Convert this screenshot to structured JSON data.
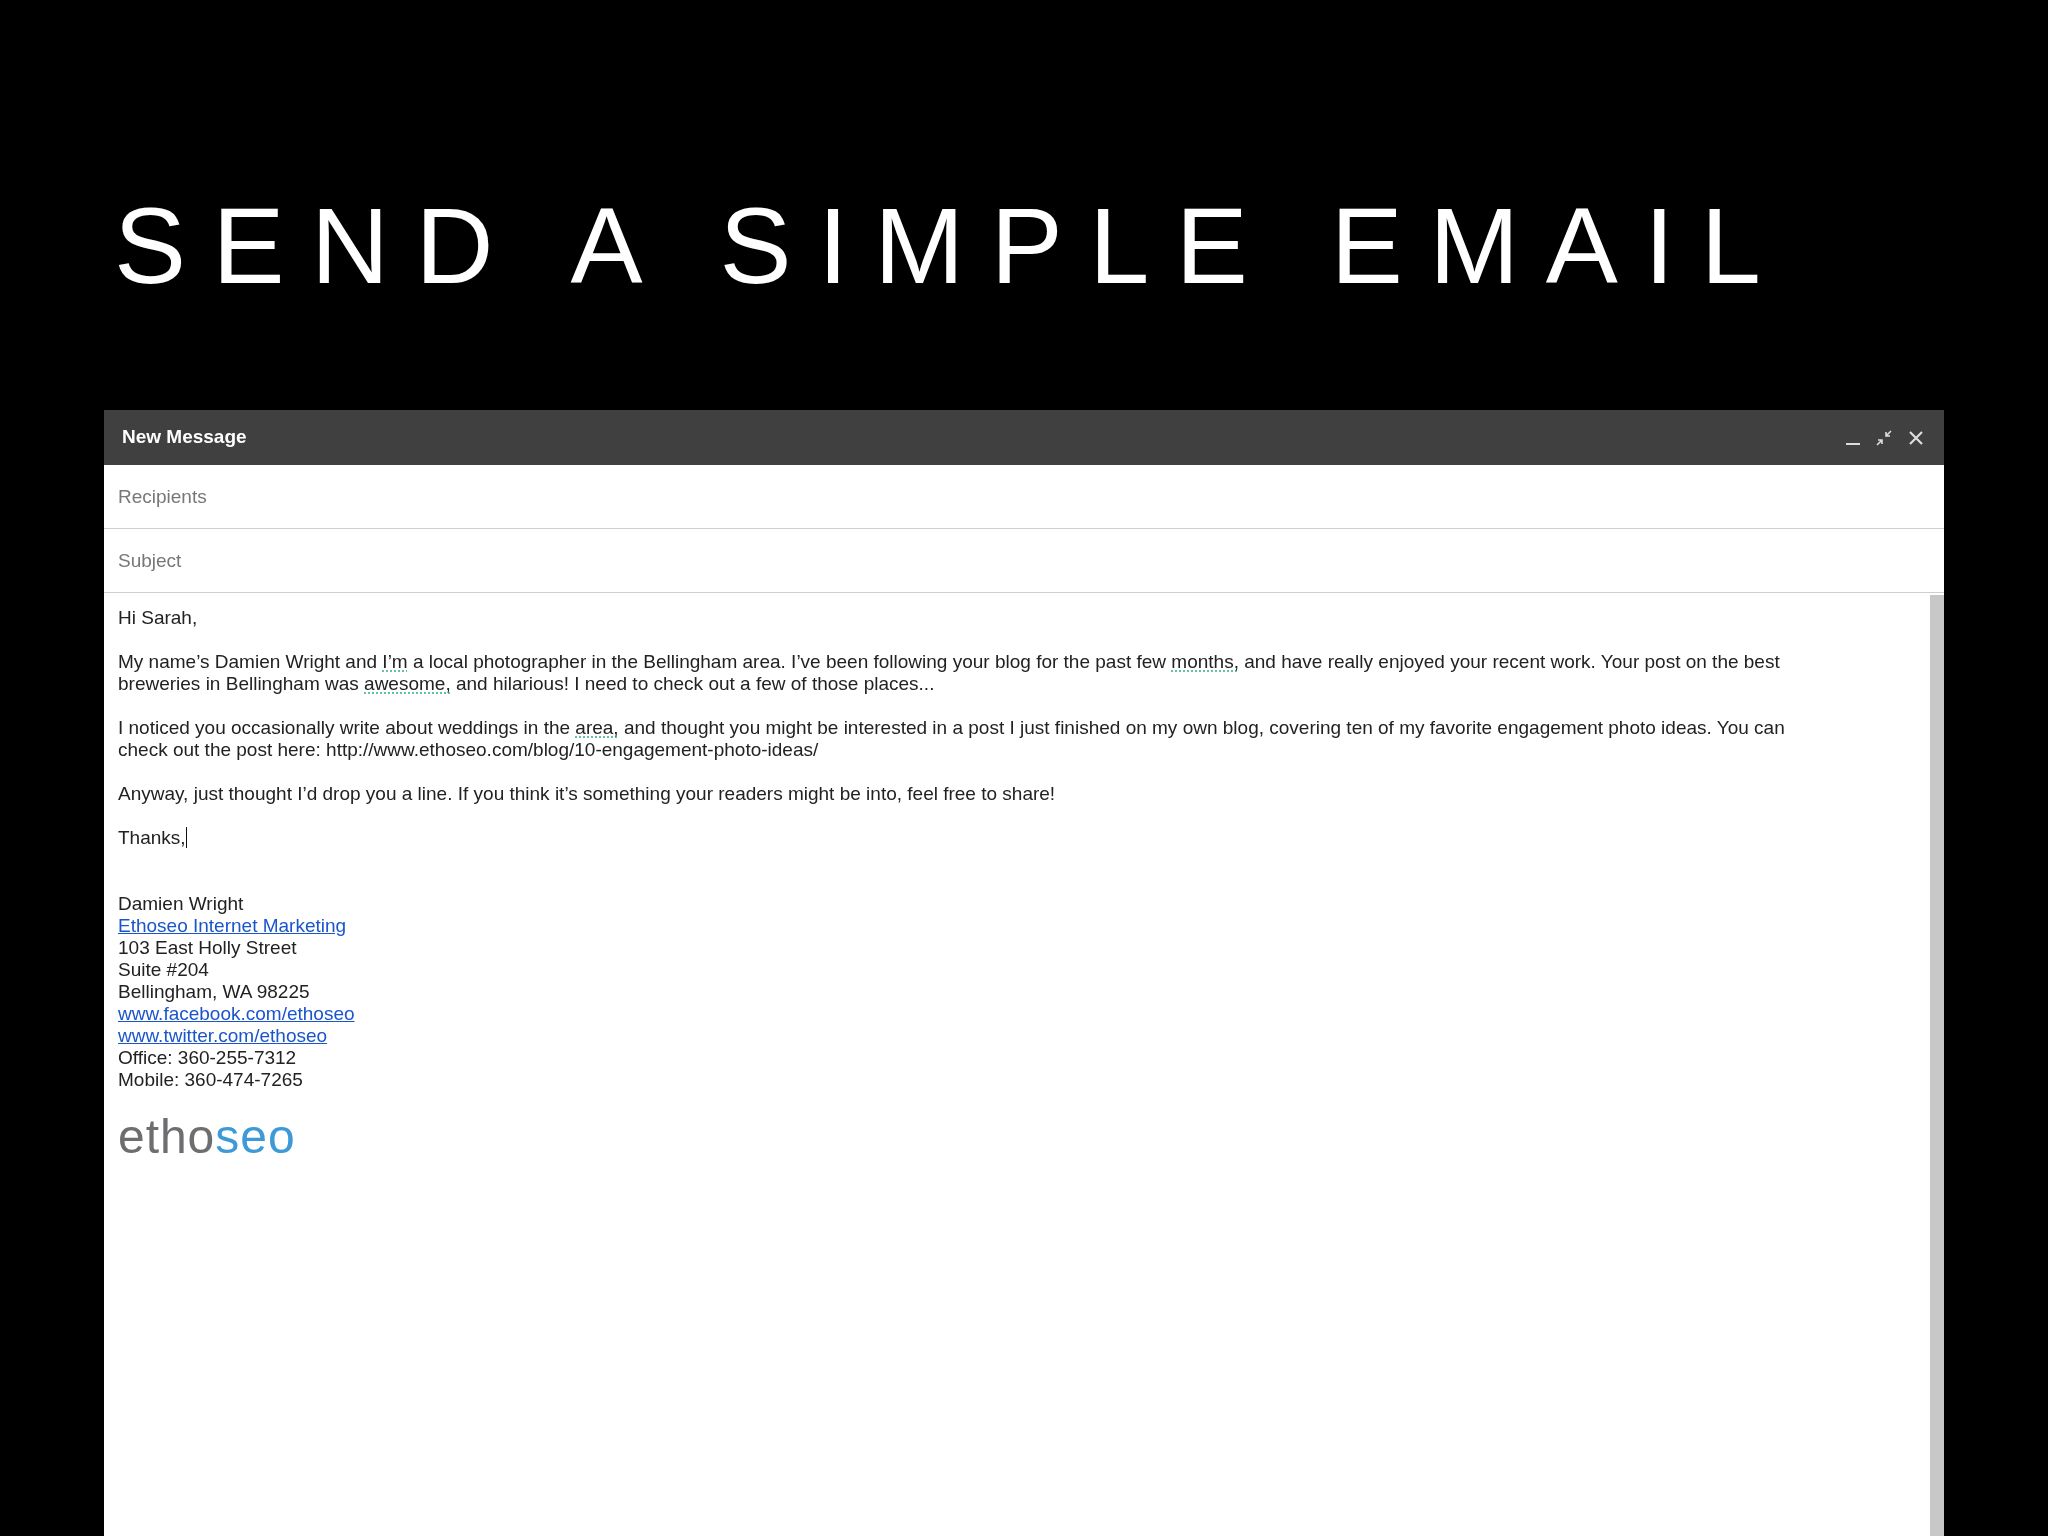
{
  "slide_title": "SEND A SIMPLE EMAIL",
  "window": {
    "title": "New Message"
  },
  "fields": [
    {
      "placeholder": "Recipients"
    },
    {
      "placeholder": "Subject"
    }
  ],
  "body": {
    "paragraphs": [
      [
        {
          "text": "Hi Sarah,",
          "flagged": false
        }
      ],
      [
        {
          "text": "My name’s Damien Wright and ",
          "flagged": false
        },
        {
          "text": "I’m",
          "flagged": true
        },
        {
          "text": " a local photographer in the Bellingham area. I’ve been following your blog for the past few ",
          "flagged": false
        },
        {
          "text": "months,",
          "flagged": true
        },
        {
          "text": " and have really enjoyed your recent work. Your post on the best breweries in Bellingham was ",
          "flagged": false
        },
        {
          "text": "awesome,",
          "flagged": true
        },
        {
          "text": " and hilarious! I need to check out a few of those places...",
          "flagged": false
        }
      ],
      [
        {
          "text": "I noticed you occasionally write about weddings in the ",
          "flagged": false
        },
        {
          "text": "area,",
          "flagged": true
        },
        {
          "text": " and thought you might be interested in a post I just finished on my own blog, covering ten of my favorite engagement photo ideas. You can check out the post here: http://www.ethoseo.com/blog/10-engagement-photo-ideas/",
          "flagged": false
        }
      ],
      [
        {
          "text": "Anyway, just thought I’d drop you a line. If you think it’s something your readers might be into, feel free to share!",
          "flagged": false
        }
      ],
      [
        {
          "text": "Thanks,",
          "flagged": false
        }
      ]
    ],
    "cursor_after_last": true
  },
  "signature": [
    {
      "kind": "text",
      "text": "Damien Wright"
    },
    {
      "kind": "link",
      "text": "Ethoseo Internet Marketing"
    },
    {
      "kind": "text",
      "text": "103 East Holly Street"
    },
    {
      "kind": "text",
      "text": "Suite #204"
    },
    {
      "kind": "text",
      "text": "Bellingham, WA 98225"
    },
    {
      "kind": "link",
      "text": "www.facebook.com/ethoseo"
    },
    {
      "kind": "link",
      "text": "www.twitter.com/ethoseo"
    },
    {
      "kind": "text",
      "text": "Office: 360-255-7312"
    },
    {
      "kind": "text",
      "text": "Mobile: 360-474-7265"
    }
  ],
  "logo": [
    {
      "text": "etho",
      "color": "#6d6e70"
    },
    {
      "text": "seo",
      "color": "#3d9ad6"
    }
  ]
}
